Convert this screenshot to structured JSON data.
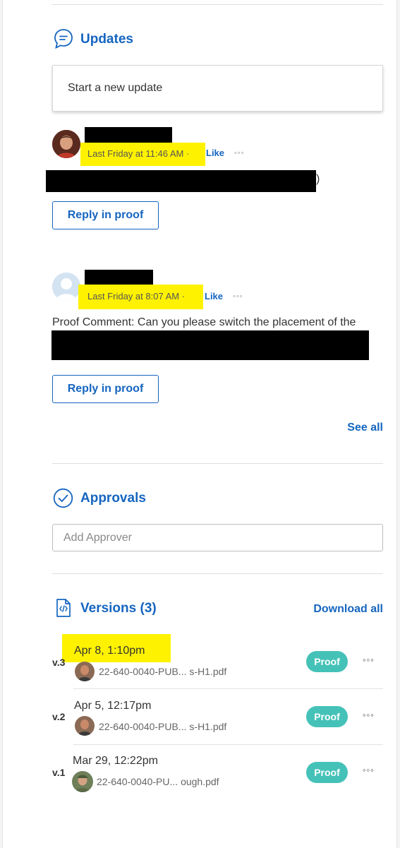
{
  "updates": {
    "title": "Updates",
    "new_update_placeholder": "Start a new update",
    "comments": [
      {
        "time": "Last Friday at 11:46 AM",
        "separator": "·",
        "like": "Like",
        "trailing_text": ")",
        "reply_label": "Reply in proof"
      },
      {
        "time": "Last Friday at 8:07 AM",
        "separator": "·",
        "like": "Like",
        "text": "Proof Comment: Can you please switch the placement of the",
        "reply_label": "Reply in proof"
      }
    ],
    "see_all": "See all"
  },
  "approvals": {
    "title": "Approvals",
    "add_placeholder": "Add Approver"
  },
  "versions": {
    "title": "Versions (3)",
    "download_all": "Download all",
    "items": [
      {
        "label": "v.3",
        "date": "Apr 8, 1:10pm",
        "file": "22-640-0040-PUB... s-H1.pdf",
        "proof": "Proof"
      },
      {
        "label": "v.2",
        "date": "Apr 5, 12:17pm",
        "file": "22-640-0040-PUB... s-H1.pdf",
        "proof": "Proof"
      },
      {
        "label": "v.1",
        "date": "Mar 29, 12:22pm",
        "file": "22-640-0040-PU... ough.pdf",
        "proof": "Proof"
      }
    ]
  },
  "icons": {
    "updates": "speech-bubble-icon",
    "approvals": "check-circle-icon",
    "versions": "file-icon",
    "more": "more-dots-icon"
  },
  "colors": {
    "accent": "#1565c0",
    "proof_pill": "#45c2b8",
    "highlight": "#fff200"
  }
}
